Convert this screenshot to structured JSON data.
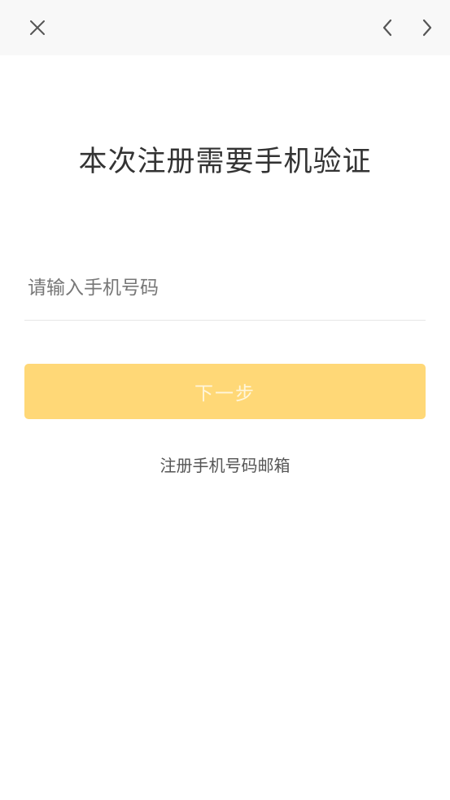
{
  "topbar": {
    "close_icon": "close-icon",
    "back_icon": "chevron-left-icon",
    "forward_icon": "chevron-right-icon"
  },
  "page": {
    "title": "本次注册需要手机验证"
  },
  "form": {
    "phone_placeholder": "请输入手机号码",
    "phone_value": "",
    "next_label": "下一步"
  },
  "links": {
    "email_register": "注册手机号码邮箱"
  },
  "colors": {
    "accent": "#ffd877",
    "topbar_bg": "#f8f8f8",
    "text": "#333333"
  }
}
